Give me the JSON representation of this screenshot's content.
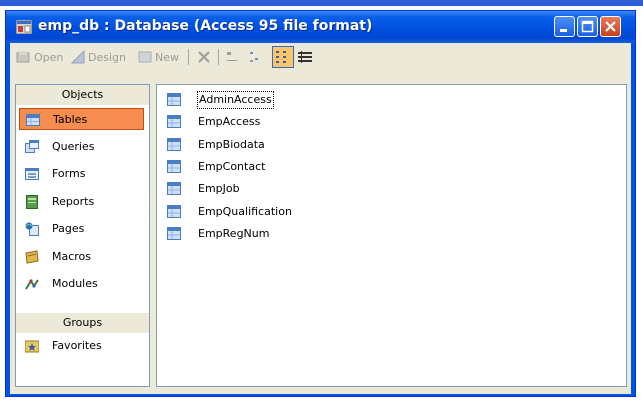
{
  "window": {
    "title": "emp_db : Database (Access 95 file format)"
  },
  "toolbar": {
    "open": "Open",
    "design": "Design",
    "new": "New"
  },
  "objects": {
    "header": "Objects",
    "items": [
      {
        "label": "Tables",
        "icon": "table-icon",
        "selected": true
      },
      {
        "label": "Queries",
        "icon": "query-icon"
      },
      {
        "label": "Forms",
        "icon": "form-icon"
      },
      {
        "label": "Reports",
        "icon": "report-icon"
      },
      {
        "label": "Pages",
        "icon": "page-icon"
      },
      {
        "label": "Macros",
        "icon": "macro-icon"
      },
      {
        "label": "Modules",
        "icon": "module-icon"
      }
    ]
  },
  "groups": {
    "header": "Groups",
    "items": [
      {
        "label": "Favorites",
        "icon": "favorites-icon"
      }
    ]
  },
  "tables": [
    "AdminAccess",
    "EmpAccess",
    "EmpBiodata",
    "EmpContact",
    "EmpJob",
    "EmpQualification",
    "EmpRegNum"
  ],
  "colors": {
    "titlebar": "#0054e3",
    "selection": "#f58c50",
    "frame": "#ece9d8"
  }
}
